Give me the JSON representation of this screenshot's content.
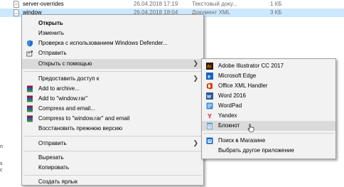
{
  "files": [
    {
      "name": "server-overrides",
      "date": "26.04.2018 17:19",
      "type": "Текстовый доку...",
      "size": "1 КБ"
    },
    {
      "name": "window",
      "date": "26.04.2018 18:04",
      "type": "Документ XML",
      "size": "3 КБ"
    }
  ],
  "left_edge": [
    "n",
    "s",
    "c"
  ],
  "context_menu": {
    "open": "Открыть",
    "edit": "Изменить",
    "defender": "Проверка с использованием Windows Defender...",
    "send_share": "Отправить",
    "open_with": "Открыть с помощью",
    "share_access": "Предоставить доступ к",
    "add_archive": "Add to archive...",
    "add_rar": "Add to \"window.rar\"",
    "compress_email": "Compress and email...",
    "compress_rar_email": "Compress to \"window.rar\" and email",
    "restore": "Восстановить прежнюю версию",
    "send_to": "Отправить",
    "cut": "Вырезать",
    "copy": "Копировать",
    "shortcut": "Создать ярлык"
  },
  "open_with_menu": {
    "illustrator": "Adobe Illustrator CC 2017",
    "edge": "Microsoft Edge",
    "office_xml": "Office XML Handler",
    "word": "Word 2016",
    "wordpad": "WordPad",
    "yandex": "Yandex",
    "notepad": "Блокнот",
    "store": "Поиск в Магазине",
    "choose": "Выбрать другое приложение"
  },
  "colors": {
    "selection": "#cce8ff",
    "menu_bg": "#f2f2f2",
    "hover": "#dadada"
  }
}
